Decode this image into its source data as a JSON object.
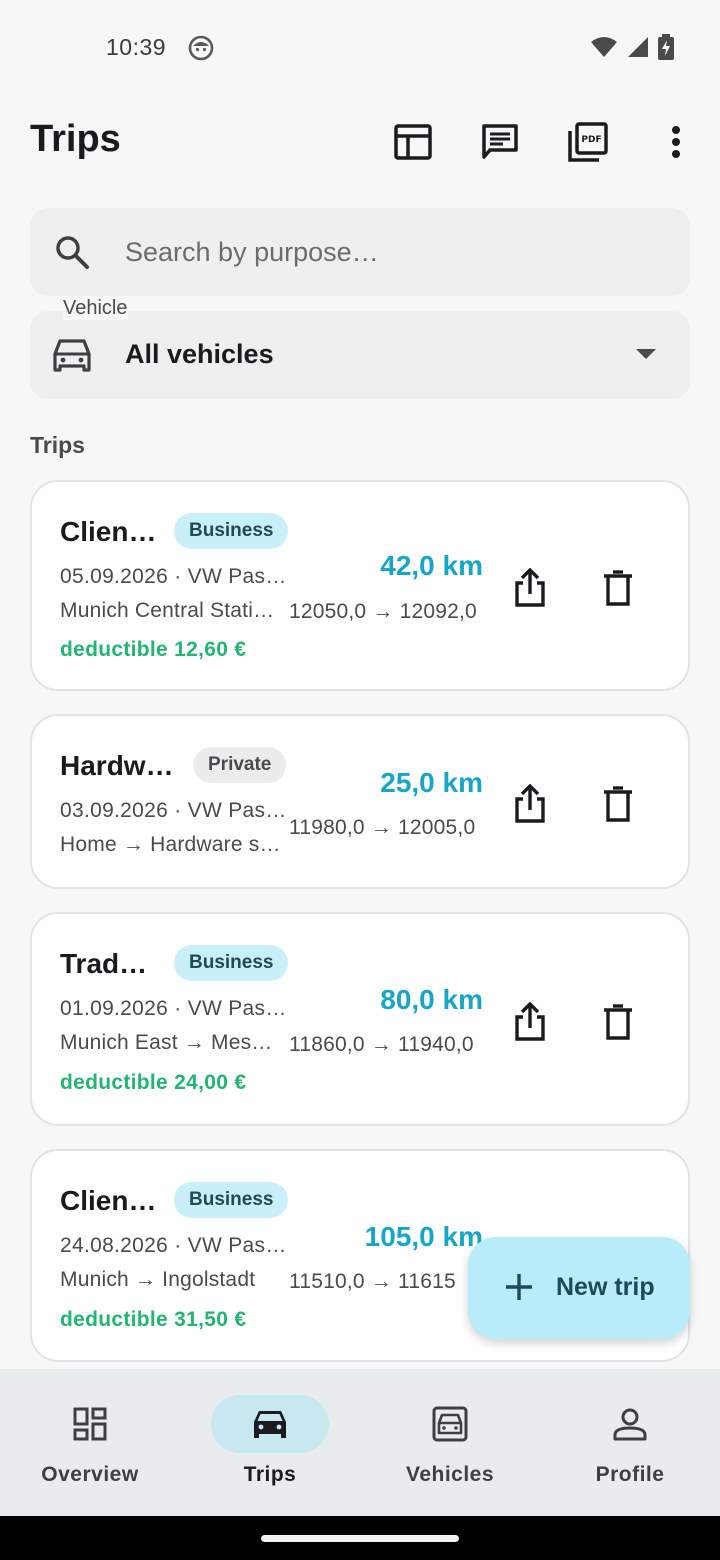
{
  "status_bar": {
    "time": "10:39"
  },
  "app_bar": {
    "title": "Trips",
    "actions": [
      "table-icon",
      "comment-icon",
      "pdf-icon",
      "more-vert-icon"
    ]
  },
  "search": {
    "placeholder": "Search by purpose…",
    "value": ""
  },
  "vehicle_filter": {
    "label": "Vehicle",
    "value": "All vehicles"
  },
  "section_title": "Trips",
  "trips": [
    {
      "title": "Clien…",
      "category": "Business",
      "date_vehicle": "05.09.2026 · VW Pas…",
      "route": "Munich Central Stati…",
      "odometer": "12050,0 → 12092,0",
      "distance": "42,0 km",
      "deductible": "deductible 12,60 €"
    },
    {
      "title": "Hardw…",
      "category": "Private",
      "date_vehicle": "03.09.2026 · VW Pas…",
      "route": "Home → Hardware s…",
      "odometer": "11980,0 → 12005,0",
      "distance": "25,0 km",
      "deductible": ""
    },
    {
      "title": "Trad…",
      "category": "Business",
      "date_vehicle": "01.09.2026 · VW Pas…",
      "route": "Munich East → Mes…",
      "odometer": "11860,0 → 11940,0",
      "distance": "80,0 km",
      "deductible": "deductible 24,00 €"
    },
    {
      "title": "Clien…",
      "category": "Business",
      "date_vehicle": "24.08.2026 · VW Pas…",
      "route": "Munich → Ingolstadt",
      "odometer": "11510,0 → 11615",
      "distance": "105,0 km",
      "deductible": "deductible 31,50 €"
    }
  ],
  "fab": {
    "label": "New trip"
  },
  "bottom_nav": [
    {
      "label": "Overview",
      "icon": "dashboard-icon",
      "active": false
    },
    {
      "label": "Trips",
      "icon": "car-icon",
      "active": true
    },
    {
      "label": "Vehicles",
      "icon": "garage-icon",
      "active": false
    },
    {
      "label": "Profile",
      "icon": "person-icon",
      "active": false
    }
  ],
  "colors": {
    "accent_km": "#17a6c8",
    "deductible_green": "#22b573",
    "fab_bg": "#b7ecf8",
    "business_badge": "#c9f0f8"
  }
}
